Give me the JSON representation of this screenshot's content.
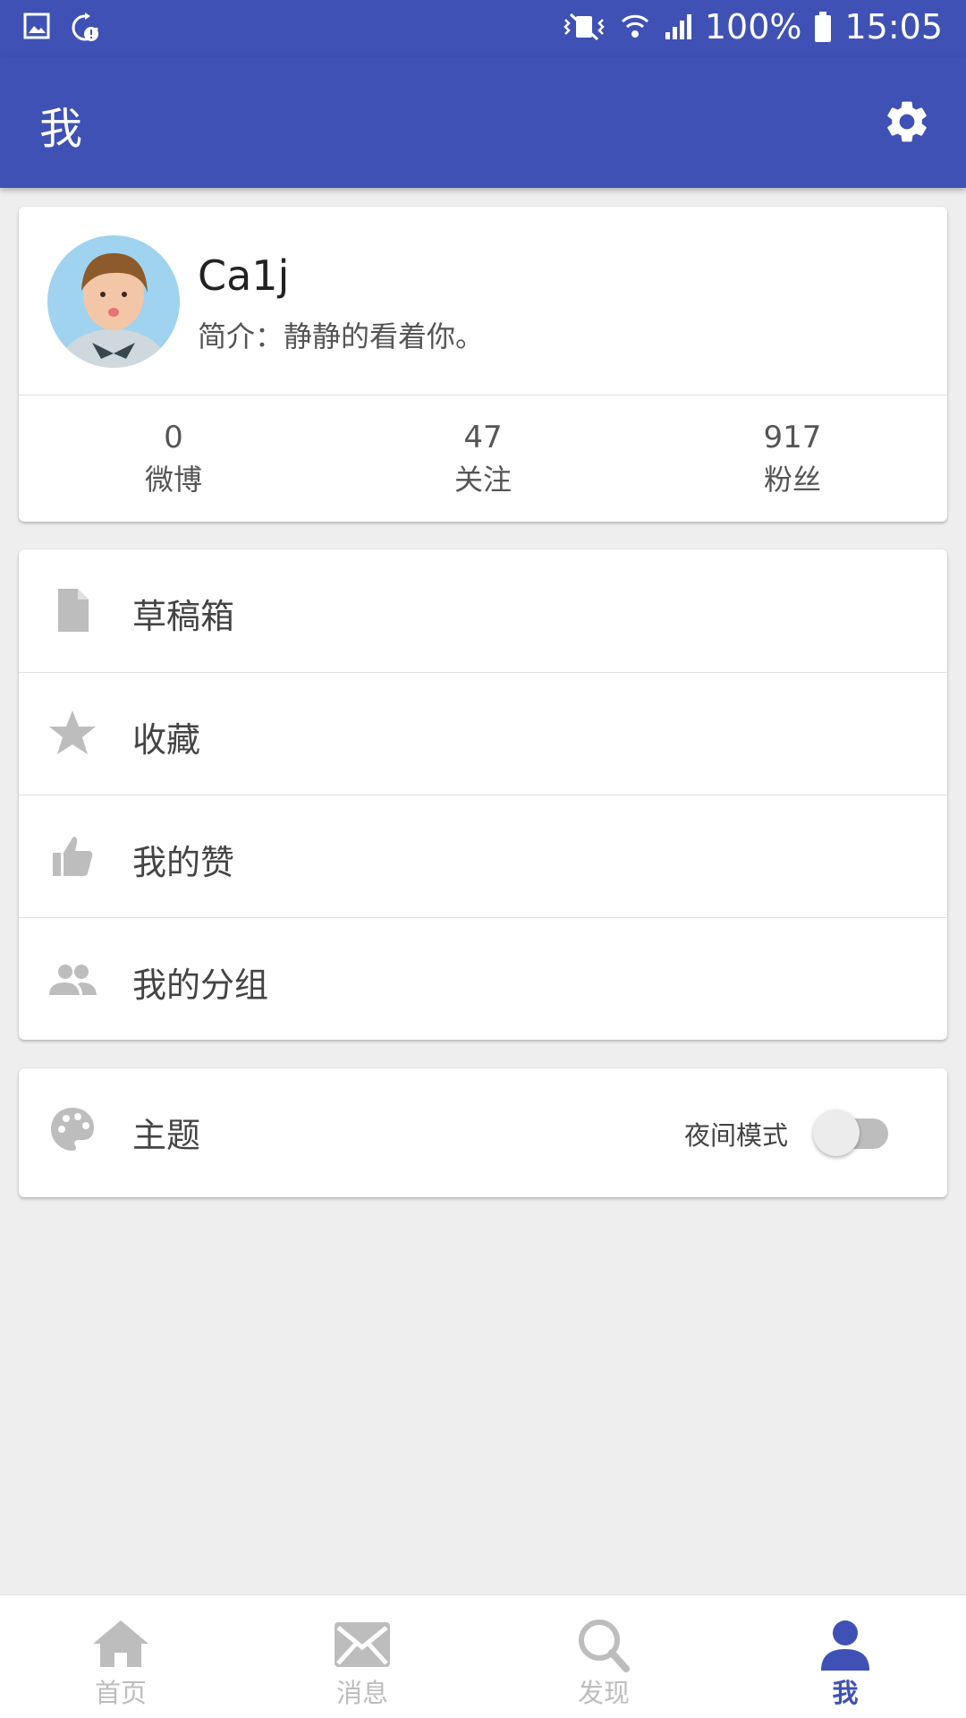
{
  "status_bar": {
    "battery": "100%",
    "time": "15:05"
  },
  "app_bar": {
    "title": "我"
  },
  "profile": {
    "username": "Ca1j",
    "bio": "简介：静静的看着你。",
    "stats": [
      {
        "value": "0",
        "label": "微博"
      },
      {
        "value": "47",
        "label": "关注"
      },
      {
        "value": "917",
        "label": "粉丝"
      }
    ]
  },
  "menu": {
    "items": [
      {
        "label": "草稿箱",
        "icon": "draft-icon"
      },
      {
        "label": "收藏",
        "icon": "star-icon"
      },
      {
        "label": "我的赞",
        "icon": "thumb-up-icon"
      },
      {
        "label": "我的分组",
        "icon": "group-icon"
      }
    ]
  },
  "theme": {
    "label": "主题",
    "night_mode_label": "夜间模式",
    "night_mode_on": false
  },
  "bottom_nav": {
    "items": [
      {
        "label": "首页",
        "icon": "home-icon"
      },
      {
        "label": "消息",
        "icon": "mail-icon"
      },
      {
        "label": "发现",
        "icon": "search-icon"
      },
      {
        "label": "我",
        "icon": "person-icon"
      }
    ],
    "active_index": 3
  },
  "colors": {
    "primary": "#3f51b5",
    "background": "#eeeeee",
    "icon_gray": "#bdbdbd"
  }
}
